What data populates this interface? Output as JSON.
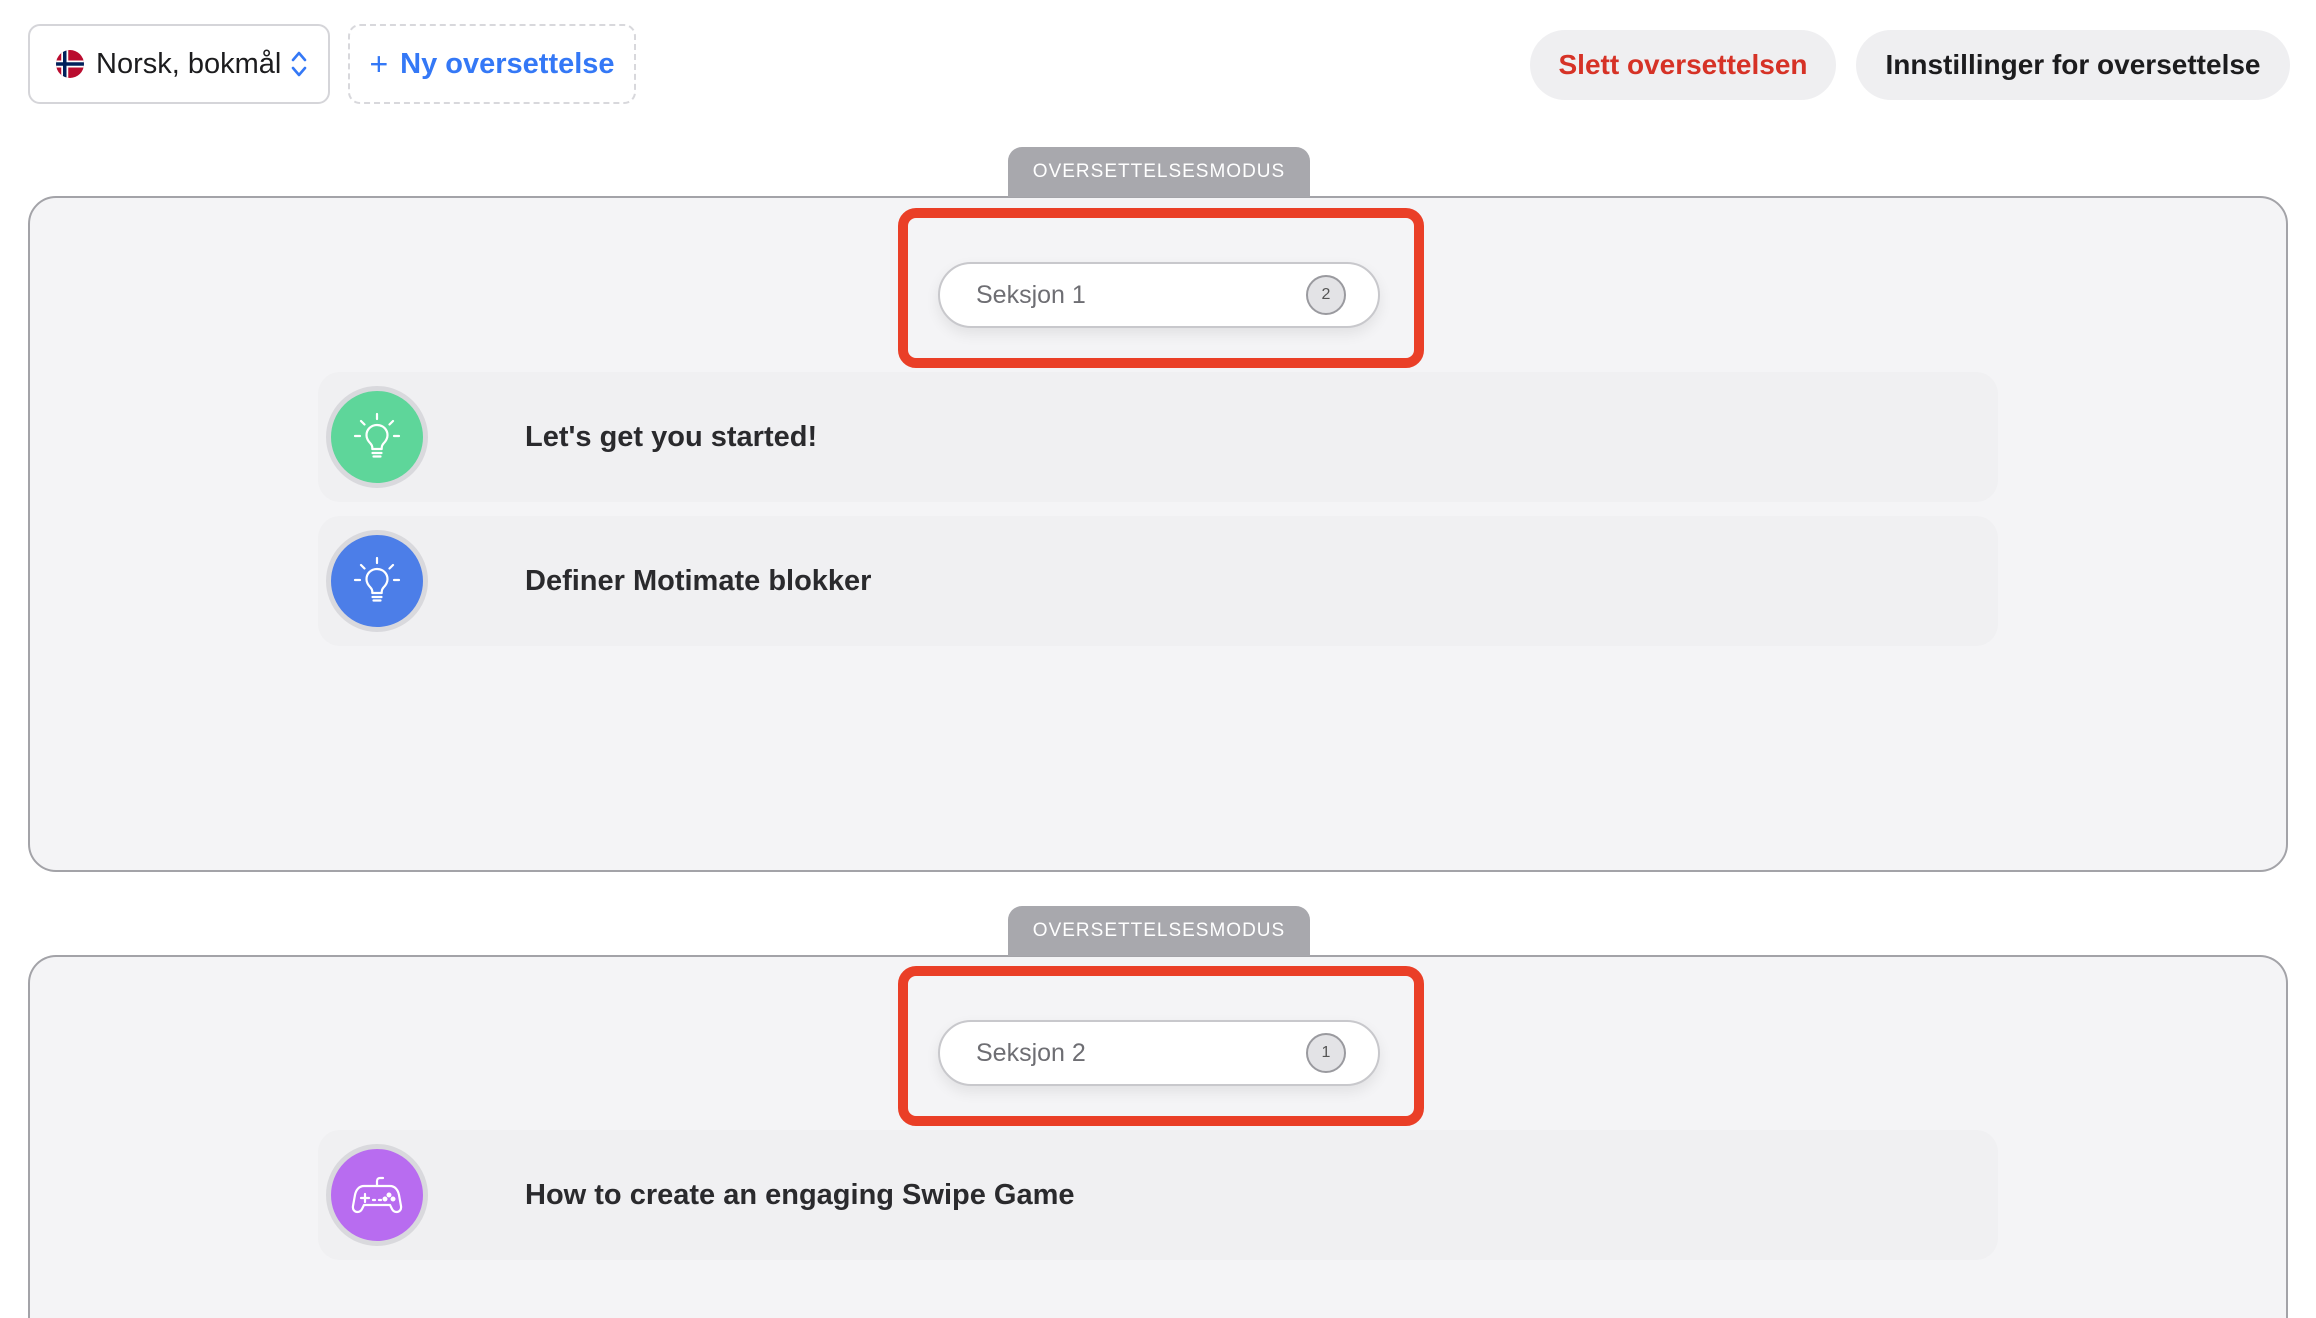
{
  "toolbar": {
    "language": "Norsk, bokmål",
    "new_translation_plus": "+",
    "new_translation_label": "Ny oversettelse",
    "delete_label": "Slett oversettelsen",
    "settings_label": "Innstillinger for oversettelse"
  },
  "sections": [
    {
      "mode_label": "OVERSETTELSESMODUS",
      "name": "Seksjon 1",
      "count": "2",
      "items": [
        {
          "title": "Let's get you started!",
          "icon": "lightbulb-icon",
          "color": "#5ed69a"
        },
        {
          "title": "Definer Motimate blokker",
          "icon": "lightbulb-icon",
          "color": "#4c7ee8"
        }
      ]
    },
    {
      "mode_label": "OVERSETTELSESMODUS",
      "name": "Seksjon 2",
      "count": "1",
      "items": [
        {
          "title": "How to create an engaging Swipe Game",
          "icon": "gamepad-icon",
          "color": "#b86cf0"
        }
      ]
    }
  ],
  "colors": {
    "accent": "#3478f6",
    "danger": "#d63226",
    "highlight": "#ea3f27"
  }
}
